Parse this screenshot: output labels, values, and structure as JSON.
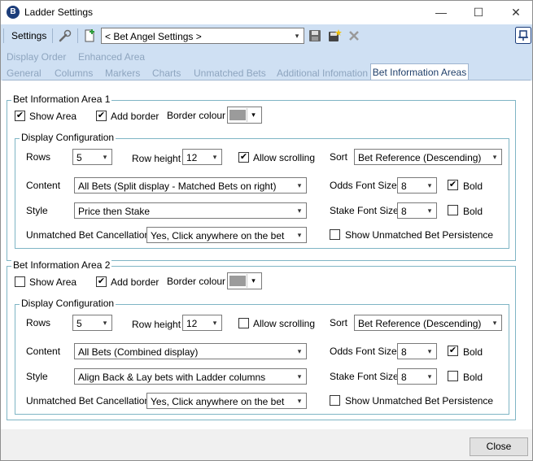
{
  "window": {
    "title": "Ladder Settings",
    "app_icon_letter": "B",
    "minimize_glyph": "—",
    "maximize_glyph": "☐",
    "close_glyph": "✕"
  },
  "toolbar": {
    "settings_label": "Settings",
    "profile_value": "< Bet Angel Settings >",
    "pin_glyph": "⊟"
  },
  "nav": {
    "top_links": [
      "Display Order",
      "Enhanced Area"
    ],
    "tabs": [
      "General",
      "Columns",
      "Markers",
      "Charts",
      "Unmatched Bets",
      "Additional Infomation",
      "Bet Information Areas"
    ],
    "active_tab": "Bet Information Areas"
  },
  "areas": [
    {
      "title": "Bet Information Area 1",
      "show_area_label": "Show Area",
      "show_area_checked": true,
      "add_border_label": "Add border",
      "add_border_checked": true,
      "border_colour_label": "Border colour",
      "border_colour": "#9b9b9b",
      "display_config_title": "Display Configuration",
      "rows_label": "Rows",
      "rows_value": "5",
      "row_height_label": "Row height",
      "row_height_value": "12",
      "allow_scrolling_label": "Allow scrolling",
      "allow_scrolling_checked": true,
      "sort_label": "Sort",
      "sort_value": "Bet Reference (Descending)",
      "content_label": "Content",
      "content_value": "All Bets (Split display - Matched Bets on right)",
      "odds_font_label": "Odds Font Size",
      "odds_font_value": "8",
      "odds_bold_label": "Bold",
      "odds_bold_checked": true,
      "style_label": "Style",
      "style_value": "Price then Stake",
      "stake_font_label": "Stake Font Size",
      "stake_font_value": "8",
      "stake_bold_label": "Bold",
      "stake_bold_checked": false,
      "cancellation_label": "Unmatched Bet Cancellation",
      "cancellation_value": "Yes, Click anywhere on the bet",
      "persistence_label": "Show Unmatched Bet Persistence",
      "persistence_checked": false
    },
    {
      "title": "Bet Information Area 2",
      "show_area_label": "Show Area",
      "show_area_checked": false,
      "add_border_label": "Add border",
      "add_border_checked": true,
      "border_colour_label": "Border colour",
      "border_colour": "#9b9b9b",
      "display_config_title": "Display Configuration",
      "rows_label": "Rows",
      "rows_value": "5",
      "row_height_label": "Row height",
      "row_height_value": "12",
      "allow_scrolling_label": "Allow scrolling",
      "allow_scrolling_checked": false,
      "sort_label": "Sort",
      "sort_value": "Bet Reference (Descending)",
      "content_label": "Content",
      "content_value": "All Bets (Combined display)",
      "odds_font_label": "Odds Font Size",
      "odds_font_value": "8",
      "odds_bold_label": "Bold",
      "odds_bold_checked": true,
      "style_label": "Style",
      "style_value": "Align Back & Lay bets with Ladder columns",
      "stake_font_label": "Stake Font Size",
      "stake_font_value": "8",
      "stake_bold_label": "Bold",
      "stake_bold_checked": false,
      "cancellation_label": "Unmatched Bet Cancellation",
      "cancellation_value": "Yes, Click anywhere on the bet",
      "persistence_label": "Show Unmatched Bet Persistence",
      "persistence_checked": false
    }
  ],
  "footer": {
    "close_label": "Close"
  },
  "colors": {
    "toolbar_bg": "#cfe0f3",
    "group_border": "#7fb5c5",
    "inactive_link": "#8ea5bf"
  },
  "glyphs": {
    "check": "✔",
    "dropdown": "▾"
  }
}
